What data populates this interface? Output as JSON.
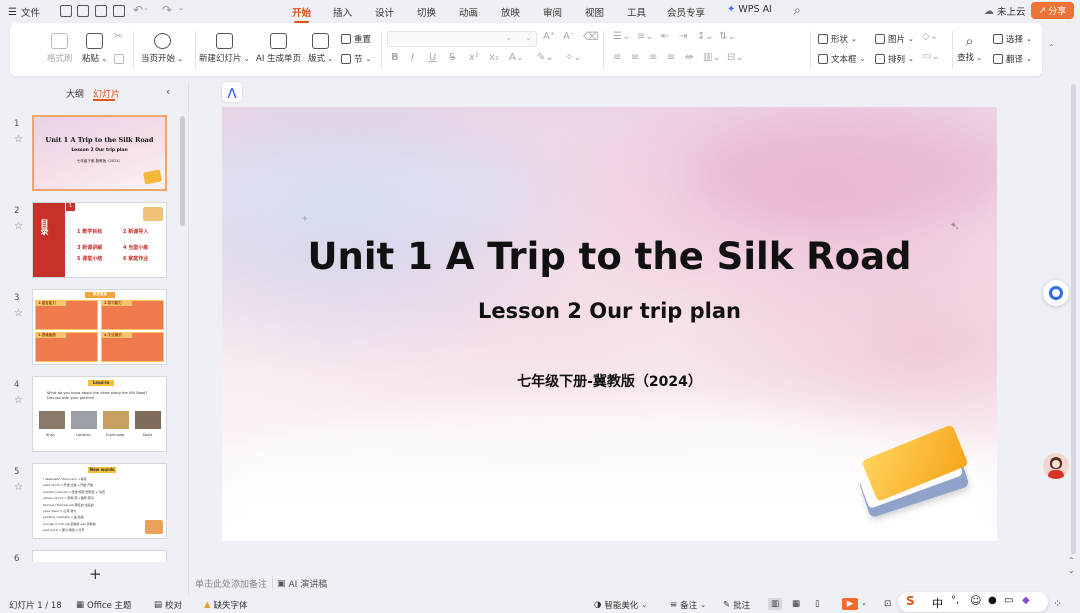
{
  "menu": {
    "file": "文件",
    "tabs": [
      "开始",
      "插入",
      "设计",
      "切换",
      "动画",
      "放映",
      "审阅",
      "视图",
      "工具",
      "会员专享"
    ],
    "wps_ai": "WPS AI",
    "cloud": "未上云",
    "share": "分享"
  },
  "ribbon": {
    "format_painter": "格式刷",
    "paste": "粘贴",
    "start_from_current": "当页开始",
    "new_slide": "新建幻灯片",
    "ai_single": "AI 生成单页",
    "layout": "版式",
    "reset": "重置",
    "section": "节",
    "font_size_label": "A",
    "shape": "形状",
    "picture": "图片",
    "textbox": "文本框",
    "arrange": "排列",
    "find": "查找",
    "select": "选择",
    "translate": "翻译"
  },
  "sidebar": {
    "tab_outline": "大纲",
    "tab_slides": "幻灯片",
    "add": "+"
  },
  "thumbs": {
    "t1": {
      "num": "1",
      "title": "Unit 1  A Trip to the Silk Road",
      "sub": "Lesson 2  Our trip plan",
      "small": "七年级下册-冀教版（2024）"
    },
    "t2": {
      "num": "2",
      "title": "目录",
      "en": "Contents",
      "badge": "1",
      "items": [
        "1  教学目标",
        "2  新课导入",
        "3  新课讲解",
        "4  当堂小练",
        "5  课堂小结",
        "6  家庭作业"
      ]
    },
    "t3": {
      "num": "3",
      "heading": "教学目标",
      "boxes": [
        "1.语言能力",
        "2.学习能力",
        "3.思维品质",
        "4.文化意识"
      ]
    },
    "t4": {
      "num": "4",
      "heading": "Lead-in",
      "question": "What do you know about the cities along the Silk Road? Discuss with your partner!",
      "cities": [
        "Xi'an",
        "Lanzhou",
        "Dunhuang",
        "Kashi"
      ]
    },
    "t5": {
      "num": "5",
      "heading": "New words",
      "lines": [
        "/ˈdestɪneɪt/ /ˈdiscovəri/ n.探索",
        "start /stɑːt/ n.开始;出发;v.开始;开始",
        "wonder /ˈwʌndə/ n.奇迹;惊奇;想知道 v. 好奇",
        "dream /driːm/ n.梦想;梦 v.做梦;梦见",
        "famous /ˈfeɪməs/ adj.著名的;出名的",
        "cave /keɪv/ n.山洞;洞穴",
        "painting /ˈpeɪntɪŋ/ n.画;绘画",
        "enough /ɪˈnʌf/ adj.足够的 adv.足够地",
        "part /pɑːt/ n.部分;角色 v.分开"
      ]
    },
    "t6": {
      "num": "6"
    }
  },
  "slide": {
    "title": "Unit 1  A Trip to the Silk Road",
    "subtitle": "Lesson 2  Our trip plan",
    "edition": "七年级下册-冀教版（2024）"
  },
  "notes": {
    "placeholder": "单击此处添加备注",
    "ai_script": "AI 演讲稿"
  },
  "status": {
    "slide_count": "幻灯片 1 / 18",
    "theme": "Office 主题",
    "proof": "校对",
    "missing_font": "缺失字体",
    "smart_beautify": "智能美化",
    "notes": "备注",
    "comments": "批注",
    "ime": "中"
  }
}
